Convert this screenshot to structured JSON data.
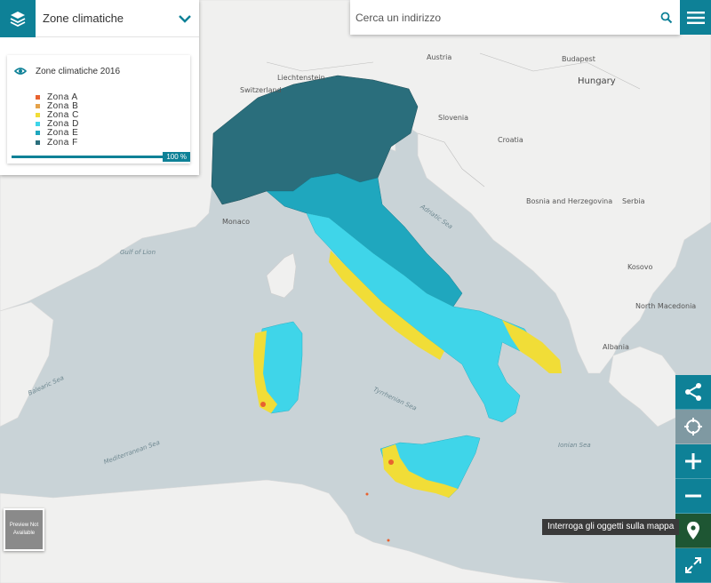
{
  "layer_panel": {
    "title": "Zone climatiche",
    "layer_name": "Zone climatiche 2016",
    "opacity": "100 %",
    "legend": [
      {
        "label": "Zona A",
        "color": "#e8622f"
      },
      {
        "label": "Zona B",
        "color": "#e5a24a"
      },
      {
        "label": "Zona C",
        "color": "#f1dd37"
      },
      {
        "label": "Zona D",
        "color": "#3fd5e9"
      },
      {
        "label": "Zona E",
        "color": "#1fa7be"
      },
      {
        "label": "Zona F",
        "color": "#2a6e7c"
      }
    ]
  },
  "search": {
    "placeholder": "Cerca un indirizzo"
  },
  "tooltip": "Interroga gli oggetti sulla mappa",
  "preview": {
    "line1": "Preview Not",
    "line2": "Available"
  },
  "toolbar": {
    "share": "share-icon",
    "locate": "crosshair-icon",
    "zoom_in": "plus-icon",
    "zoom_out": "minus-icon",
    "identify": "map-marker-icon",
    "fullscreen": "expand-icon"
  },
  "map_labels": {
    "hungary": "Hungary",
    "switzerland": "Switzerland",
    "liechtenstein": "Liechtenstein",
    "austria": "Austria",
    "slovenia": "Slovenia",
    "croatia": "Croatia",
    "bosnia": "Bosnia and Herzegovina",
    "serbia": "Serbia",
    "kosovo": "Kosovo",
    "north_macedonia": "North Macedonia",
    "albania": "Albania",
    "monaco": "Monaco",
    "budapest": "Budapest",
    "gulf_lion": "Gulf of Lion",
    "balearic_sea": "Balearic Sea",
    "mediterranean_sea": "Mediterranean Sea",
    "tyrrhenian_sea": "Tyrrhenian Sea",
    "adriatic_sea": "Adriatic Sea",
    "ionian_sea": "Ionian Sea"
  },
  "colors": {
    "accent": "#0e8197",
    "active_tool": "#1e5633",
    "water": "#c9d3d7",
    "land": "#f1f1f0"
  }
}
